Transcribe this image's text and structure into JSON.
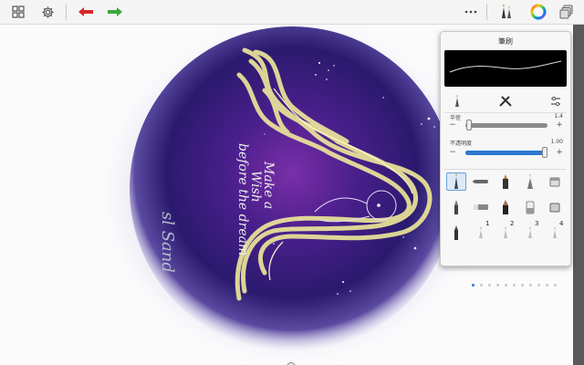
{
  "toolbar": {
    "left_icons": [
      "grid-icon",
      "gear-icon",
      "undo-icon",
      "redo-icon"
    ],
    "right_icons": [
      "more-icon",
      "brush-library-icon",
      "color-wheel-icon",
      "layers-icon"
    ],
    "undo_color": "#d9262c",
    "redo_color": "#3ea63a"
  },
  "artwork": {
    "text_lines": [
      "Make a",
      "Wish",
      "before the dream"
    ],
    "signature": "sl Sand",
    "hair_color": "#f3ee9a",
    "circle_color": "#3a1d7a"
  },
  "brush_panel": {
    "title": "筆刷",
    "tab_icons": [
      "brush-properties-icon",
      "brush-tools-icon",
      "brush-settings-icon"
    ],
    "params": [
      {
        "label": "半徑",
        "value": "1.4",
        "fraction": 0.04
      },
      {
        "label": "不透明度",
        "value": "1.00",
        "fraction": 1.0
      }
    ],
    "minus_label": "−",
    "plus_label": "+",
    "brushes": [
      "pencil-brush-icon",
      "ballpoint-brush-icon",
      "marker-brush-icon",
      "airbrush-icon",
      "eraser-brush-icon",
      "paint-brush-icon",
      "hard-eraser-icon",
      "felt-tip-brush-icon",
      "soft-eraser-icon",
      "smudge-brush-icon",
      "ink-pen-icon",
      "custom-brush-1-icon",
      "custom-brush-2-icon",
      "custom-brush-3-icon",
      "custom-brush-4-icon"
    ],
    "selected_brush": 0,
    "slot_numbers": [
      "1",
      "2",
      "3",
      "4"
    ],
    "page_count": 11,
    "active_page": 0,
    "accent": "#2b78d0"
  }
}
